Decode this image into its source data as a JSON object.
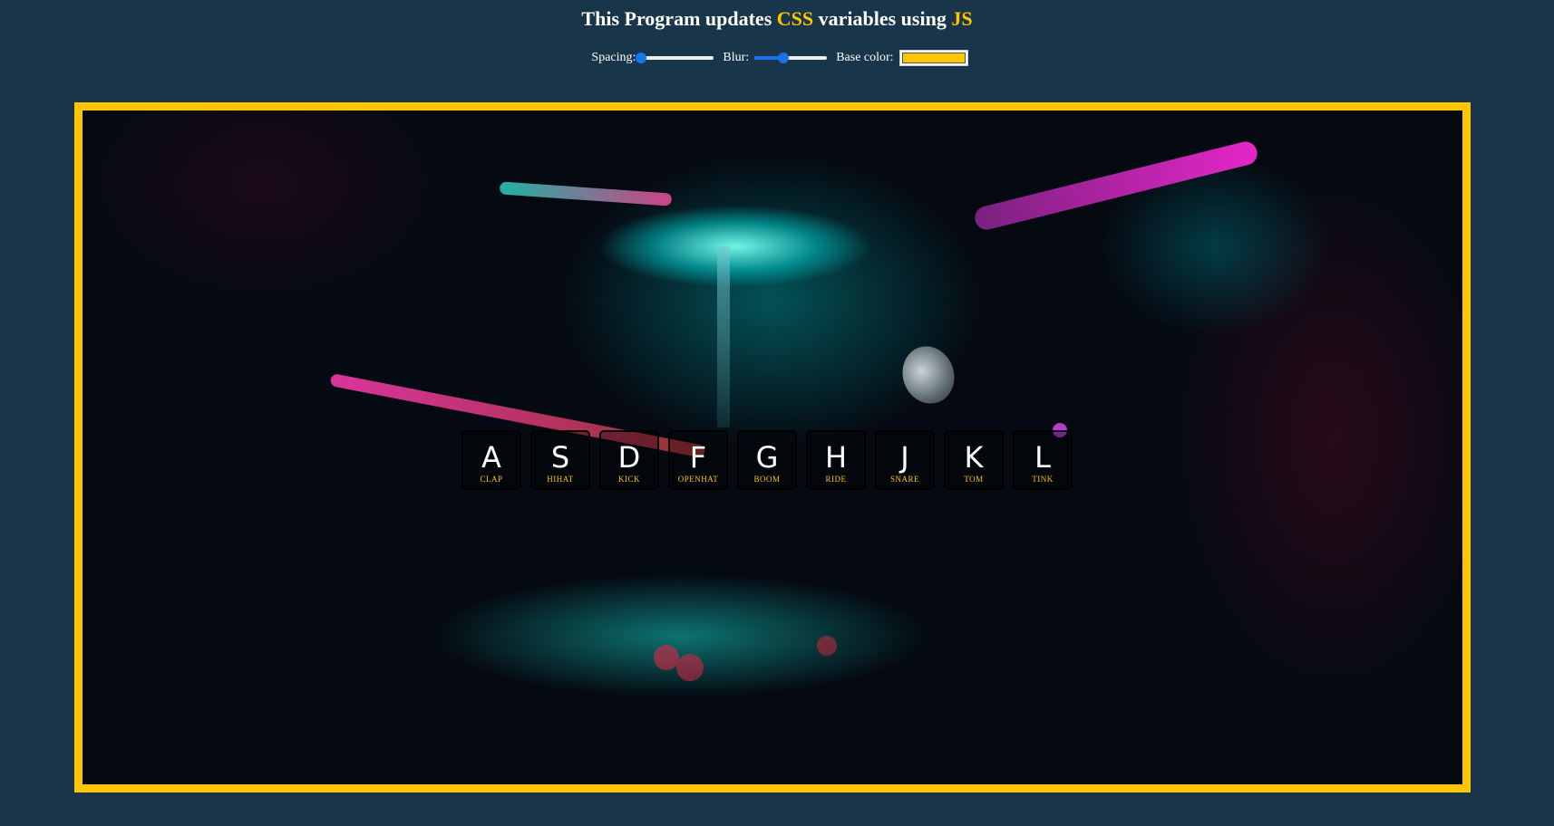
{
  "title": {
    "part1": "This Program updates ",
    "part2": "CSS",
    "part3": " variables using ",
    "part4": "JS"
  },
  "controls": {
    "spacing_label": "Spacing:",
    "spacing_value": 10,
    "spacing_min": 10,
    "spacing_max": 200,
    "blur_label": "Blur:",
    "blur_value": 10,
    "blur_min": 0,
    "blur_max": 25,
    "base_label": "Base color:",
    "base_value": "#ffc600"
  },
  "colors": {
    "background": "#193549",
    "accent": "#ffc600",
    "slider": "#1a73e8"
  },
  "keys": [
    {
      "key": "A",
      "sound": "clap"
    },
    {
      "key": "S",
      "sound": "hihat"
    },
    {
      "key": "D",
      "sound": "kick"
    },
    {
      "key": "F",
      "sound": "openhat"
    },
    {
      "key": "G",
      "sound": "boom"
    },
    {
      "key": "H",
      "sound": "ride"
    },
    {
      "key": "J",
      "sound": "snare"
    },
    {
      "key": "K",
      "sound": "tom"
    },
    {
      "key": "L",
      "sound": "tink"
    }
  ]
}
